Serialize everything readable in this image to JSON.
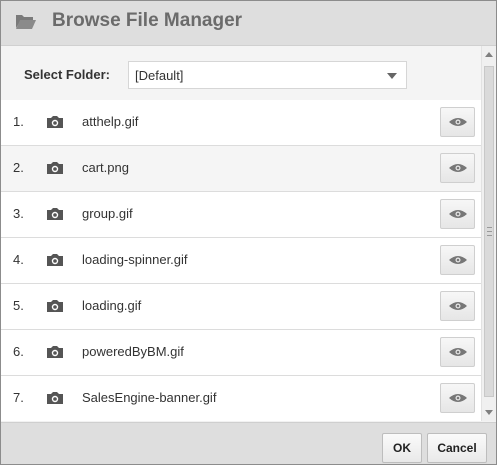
{
  "dialog": {
    "title": "Browse File Manager",
    "title_icon": "folder-open-icon"
  },
  "folder": {
    "label": "Select Folder:",
    "selected": "[Default]"
  },
  "files": [
    {
      "num": "1.",
      "name": "atthelp.gif",
      "icon": "camera-icon"
    },
    {
      "num": "2.",
      "name": "cart.png",
      "icon": "camera-icon"
    },
    {
      "num": "3.",
      "name": "group.gif",
      "icon": "camera-icon"
    },
    {
      "num": "4.",
      "name": "loading-spinner.gif",
      "icon": "camera-icon"
    },
    {
      "num": "5.",
      "name": "loading.gif",
      "icon": "camera-icon"
    },
    {
      "num": "6.",
      "name": "poweredByBM.gif",
      "icon": "camera-icon"
    },
    {
      "num": "7.",
      "name": "SalesEngine-banner.gif",
      "icon": "camera-icon"
    }
  ],
  "preview_icon": "eye-icon",
  "footer": {
    "ok_label": "OK",
    "cancel_label": "Cancel"
  },
  "colors": {
    "header_bg": "#dedede",
    "title_text": "#6b6b6b",
    "row_alt_bg": "#f5f5f5",
    "icon_gray": "#555555"
  }
}
